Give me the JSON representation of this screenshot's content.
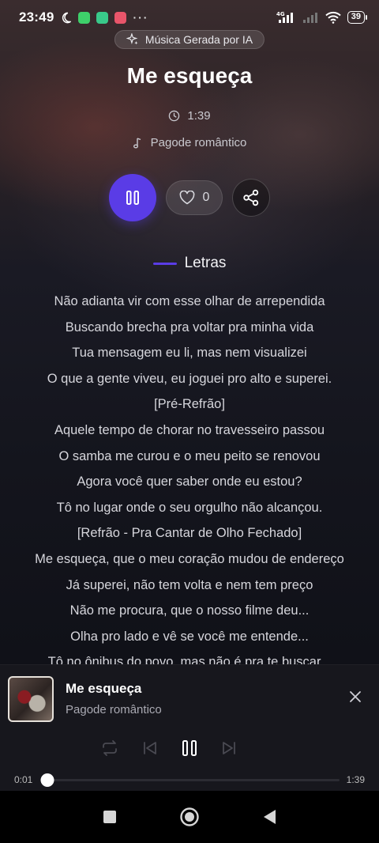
{
  "status_bar": {
    "time": "23:49",
    "more": "···",
    "network": "4G",
    "battery": "39"
  },
  "badge": {
    "label": "Música Gerada por IA"
  },
  "song": {
    "title": "Me esqueça",
    "duration": "1:39",
    "genre": "Pagode romântico"
  },
  "actions": {
    "likes": "0"
  },
  "lyrics": {
    "header": "Letras",
    "lines": [
      "Não adianta vir com esse olhar de arrependida",
      "Buscando brecha pra voltar pra minha vida",
      "Tua mensagem eu li, mas nem visualizei",
      "O que a gente viveu, eu joguei pro alto e superei.",
      "[Pré-Refrão]",
      "Aquele tempo de chorar no travesseiro passou",
      "O samba me curou e o meu peito se renovou",
      "Agora você quer saber onde eu estou?",
      "Tô no lugar onde o seu orgulho não alcançou.",
      "[Refrão - Pra Cantar de Olho Fechado]",
      "Me esqueça, que o meu coração mudou de endereço",
      "Já superei, não tem volta e nem tem preço",
      "Não me procura, que o nosso filme deu...",
      "Olha pro lado e vê se você me entende...",
      "Tô no ônibus do povo, mas não é pra te buscar..."
    ]
  },
  "player": {
    "title": "Me esqueça",
    "subtitle": "Pagode romântico",
    "current_time": "0:01",
    "total_time": "1:39",
    "progress": 0.01
  },
  "colors": {
    "accent": "#5a3ce6",
    "player_bg": "#17171d"
  }
}
